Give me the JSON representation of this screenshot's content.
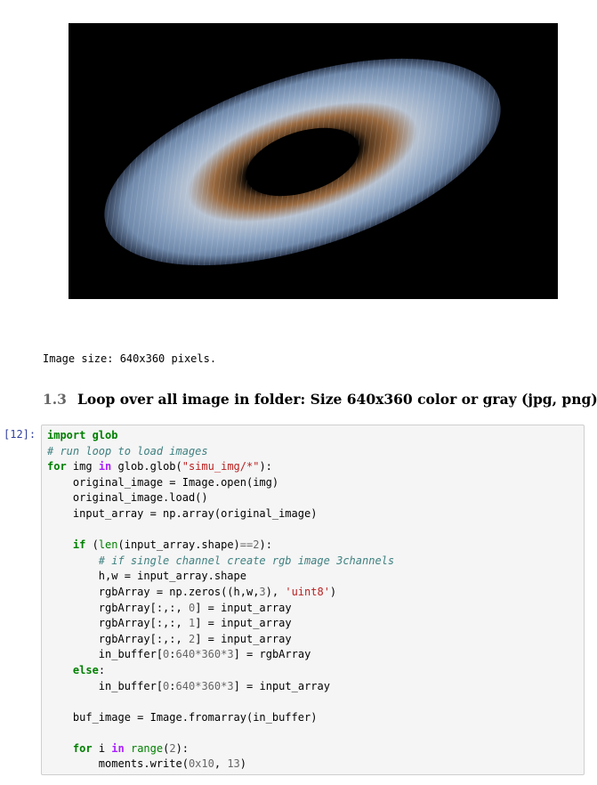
{
  "output_image": {
    "alt": "iris"
  },
  "text_output": "Image size: 640x360 pixels.",
  "section": {
    "number": "1.3",
    "title": "Loop over all image in folder: Size 640x360 color or gray (jpg, png)"
  },
  "cell": {
    "prompt": "[12]:",
    "code": {
      "l1_kw": "import",
      "l1_mod": " glob",
      "l2_comment": "# run loop to load images",
      "l3_for": "for",
      "l3_a": " img ",
      "l3_in": "in",
      "l3_b": " glob.glob(",
      "l3_str": "\"simu_img/*\"",
      "l3_c": "):",
      "l4": "    original_image = Image.open(img)",
      "l5": "    original_image.load()",
      "l6": "    input_array = np.array(original_image)",
      "l8_indent": "    ",
      "l8_if": "if",
      "l8_a": " (",
      "l8_len": "len",
      "l8_b": "(input_array.shape)",
      "l8_op": "==",
      "l8_num": "2",
      "l8_c": "):",
      "l9_indent": "        ",
      "l9_comment": "# if single channel create rgb image 3channels",
      "l10": "        h,w = input_array.shape",
      "l11_a": "        rgbArray = np.zeros((h,w,",
      "l11_num": "3",
      "l11_b": "), ",
      "l11_str": "'uint8'",
      "l11_c": ")",
      "l12_a": "        rgbArray[:,:, ",
      "l12_num": "0",
      "l12_b": "] = input_array",
      "l13_a": "        rgbArray[:,:, ",
      "l13_num": "1",
      "l13_b": "] = input_array",
      "l14_a": "        rgbArray[:,:, ",
      "l14_num": "2",
      "l14_b": "] = input_array",
      "l15_a": "        in_buffer[",
      "l15_n1": "0",
      "l15_b": ":",
      "l15_n2": "640",
      "l15_op1": "*",
      "l15_n3": "360",
      "l15_op2": "*",
      "l15_n4": "3",
      "l15_c": "] = rgbArray",
      "l16_indent": "    ",
      "l16_else": "else",
      "l16_a": ":",
      "l17_a": "        in_buffer[",
      "l17_n1": "0",
      "l17_b": ":",
      "l17_n2": "640",
      "l17_op1": "*",
      "l17_n3": "360",
      "l17_op2": "*",
      "l17_n4": "3",
      "l17_c": "] = input_array",
      "l19": "    buf_image = Image.fromarray(in_buffer)",
      "l21_indent": "    ",
      "l21_for": "for",
      "l21_a": " i ",
      "l21_in": "in",
      "l21_b": " ",
      "l21_range": "range",
      "l21_c": "(",
      "l21_num": "2",
      "l21_d": "):",
      "l22_a": "        moments.write(",
      "l22_n1": "0x10",
      "l22_b": ", ",
      "l22_n2": "13",
      "l22_c": ")"
    }
  },
  "colors": {
    "keyword": "#008000",
    "operator_word": "#aa22ff",
    "string": "#ba2121",
    "comment": "#408080",
    "number": "#666666",
    "prompt": "#303f9f",
    "cell_bg": "#f5f5f5",
    "cell_border": "#cfcfcf"
  }
}
